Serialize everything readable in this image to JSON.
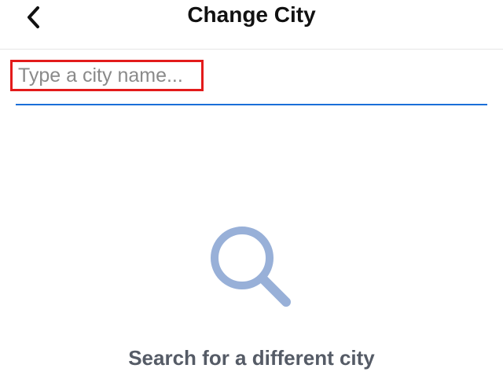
{
  "header": {
    "title": "Change City",
    "back_icon": "chevron-left-icon"
  },
  "search": {
    "placeholder": "Type a city name...",
    "value": "",
    "highlight_color": "#e31b1b",
    "underline_color": "#1a6fd8"
  },
  "empty_state": {
    "icon": "magnifier-icon",
    "icon_color": "#98b0d8",
    "message": "Search for a different city"
  }
}
